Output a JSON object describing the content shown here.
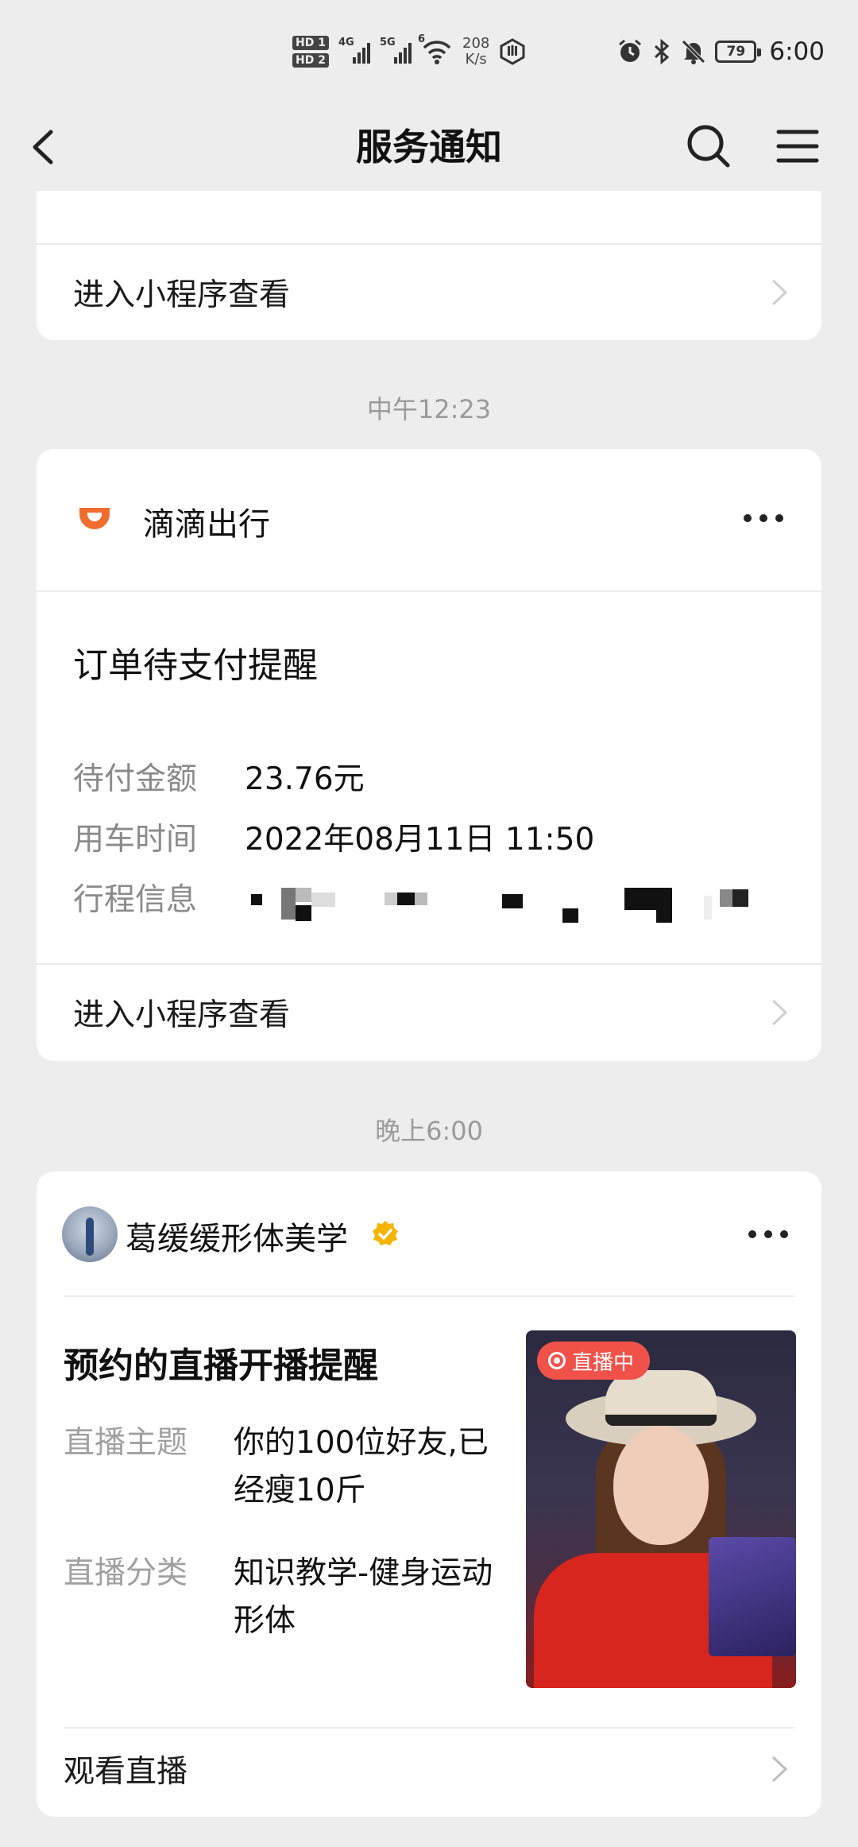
{
  "status_bar": {
    "hd_badges": [
      "HD 1",
      "HD 2"
    ],
    "signal_1_label": "4G",
    "signal_2_label": "5G",
    "wifi_label": "6",
    "speed_value": "208",
    "speed_unit": "K/s",
    "battery": "79",
    "time": "6:00"
  },
  "header": {
    "title": "服务通知"
  },
  "card_top": {
    "link_label": "进入小程序查看"
  },
  "timestamp_1": "中午12:23",
  "didi_card": {
    "app_name": "滴滴出行",
    "notify_title": "订单待支付提醒",
    "rows": [
      {
        "key": "待付金额",
        "value": "23.76元"
      },
      {
        "key": "用车时间",
        "value": "2022年08月11日 11:50"
      },
      {
        "key": "行程信息",
        "value": ""
      }
    ],
    "link_label": "进入小程序查看",
    "brand_color": "#f06d2e"
  },
  "timestamp_2": "晚上6:00",
  "live_card": {
    "app_name": "葛缓缓形体美学",
    "notify_title": "预约的直播开播提醒",
    "rows": [
      {
        "key": "直播主题",
        "value": "你的100位好友,已经瘦10斤"
      },
      {
        "key": "直播分类",
        "value": "知识教学-健身运动形体"
      }
    ],
    "live_badge": "直播中",
    "link_label": "观看直播",
    "badge_color": "#f0524a",
    "verified_color": "#f5b400"
  }
}
